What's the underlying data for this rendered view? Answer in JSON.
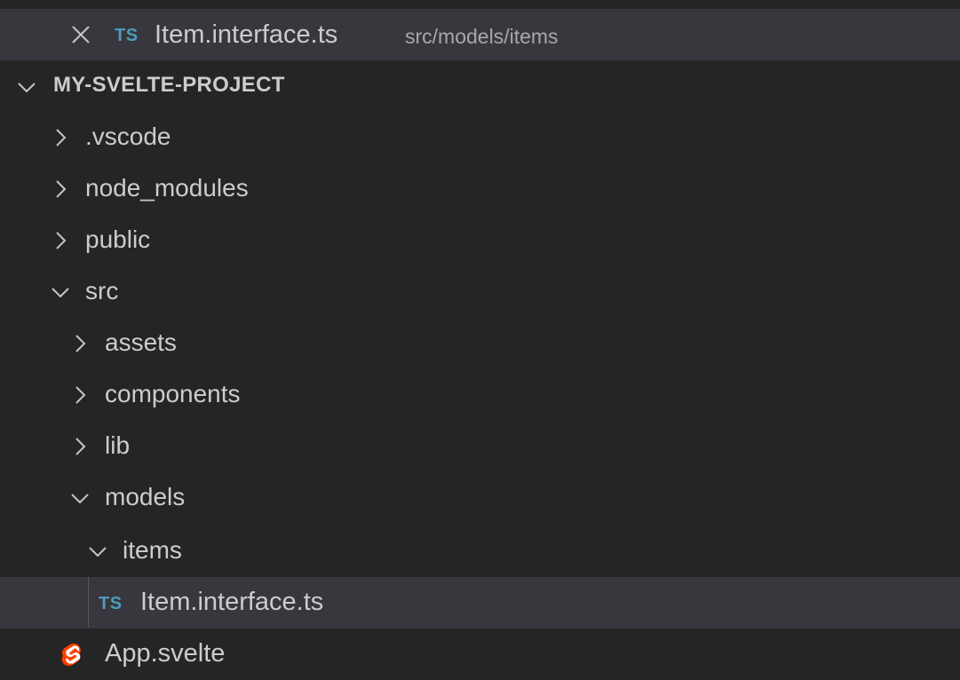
{
  "open_editor": {
    "badge": "TS",
    "file_name": "Item.interface.ts",
    "path": "src/models/items"
  },
  "project": {
    "name": "MY-SVELTE-PROJECT"
  },
  "tree": {
    "vscode": ".vscode",
    "node_modules": "node_modules",
    "public": "public",
    "src": "src",
    "assets": "assets",
    "components": "components",
    "lib": "lib",
    "models": "models",
    "items": "items",
    "item_file_badge": "TS",
    "item_file": "Item.interface.ts",
    "app_svelte": "App.svelte"
  },
  "colors": {
    "background": "#252526",
    "selected_row": "#37373d",
    "text": "#cccccc",
    "path_text": "#a8a8a8",
    "ts_badge": "#519aba",
    "svelte_icon": "#ff3e00"
  }
}
